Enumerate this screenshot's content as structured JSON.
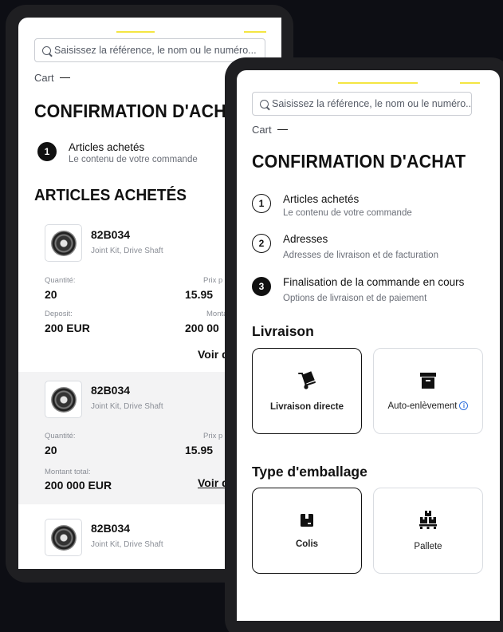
{
  "search": {
    "placeholder": "Saisissez la référence, le nom ou le numéro..."
  },
  "breadcrumb": {
    "cart": "Cart"
  },
  "title": "CONFIRMATION D'ACHAT",
  "steps": [
    {
      "number": "1",
      "title": "Articles achetés",
      "subtitle": "Le contenu de votre commande"
    },
    {
      "number": "2",
      "title": "Adresses",
      "subtitle": "Adresses de livraison et de facturation"
    },
    {
      "number": "3",
      "title": "Finalisation de la commande en cours",
      "subtitle": "Options de livraison et de paiement"
    }
  ],
  "back": {
    "section_title": "ARTICLES ACHETÉS",
    "items": [
      {
        "ref": "82B034",
        "desc": "Joint Kit, Drive Shaft",
        "qty_label": "Quantité:",
        "qty": "20",
        "price_label": "Prix p",
        "price": "15.95",
        "deposit_label": "Deposit:",
        "deposit": "200 EUR",
        "amount_label": "Monta",
        "amount": "200 00",
        "link": "Voir d"
      },
      {
        "ref": "82B034",
        "desc": "Joint Kit, Drive Shaft",
        "qty_label": "Quantité:",
        "qty": "20",
        "price_label": "Prix p",
        "price": "15.95",
        "total_label": "Montant total:",
        "total": "200 000 EUR",
        "link": "Voir d"
      },
      {
        "ref": "82B034",
        "desc": "Joint Kit, Drive Shaft"
      }
    ]
  },
  "front": {
    "delivery": {
      "title": "Livraison",
      "options": [
        {
          "label": "Livraison directe",
          "icon": "hand-truck-icon",
          "selected": true
        },
        {
          "label": "Auto-enlèvement",
          "icon": "archive-box-icon",
          "selected": false,
          "info": "i"
        }
      ]
    },
    "packaging": {
      "title": "Type d'emballage",
      "options": [
        {
          "label": "Colis",
          "icon": "parcel-icon",
          "selected": true
        },
        {
          "label": "Pallete",
          "icon": "pallet-icon",
          "selected": false
        }
      ]
    }
  },
  "colors": {
    "accent": "#f4e642",
    "background": "#0d0e14",
    "frame": "#1f1f22"
  }
}
